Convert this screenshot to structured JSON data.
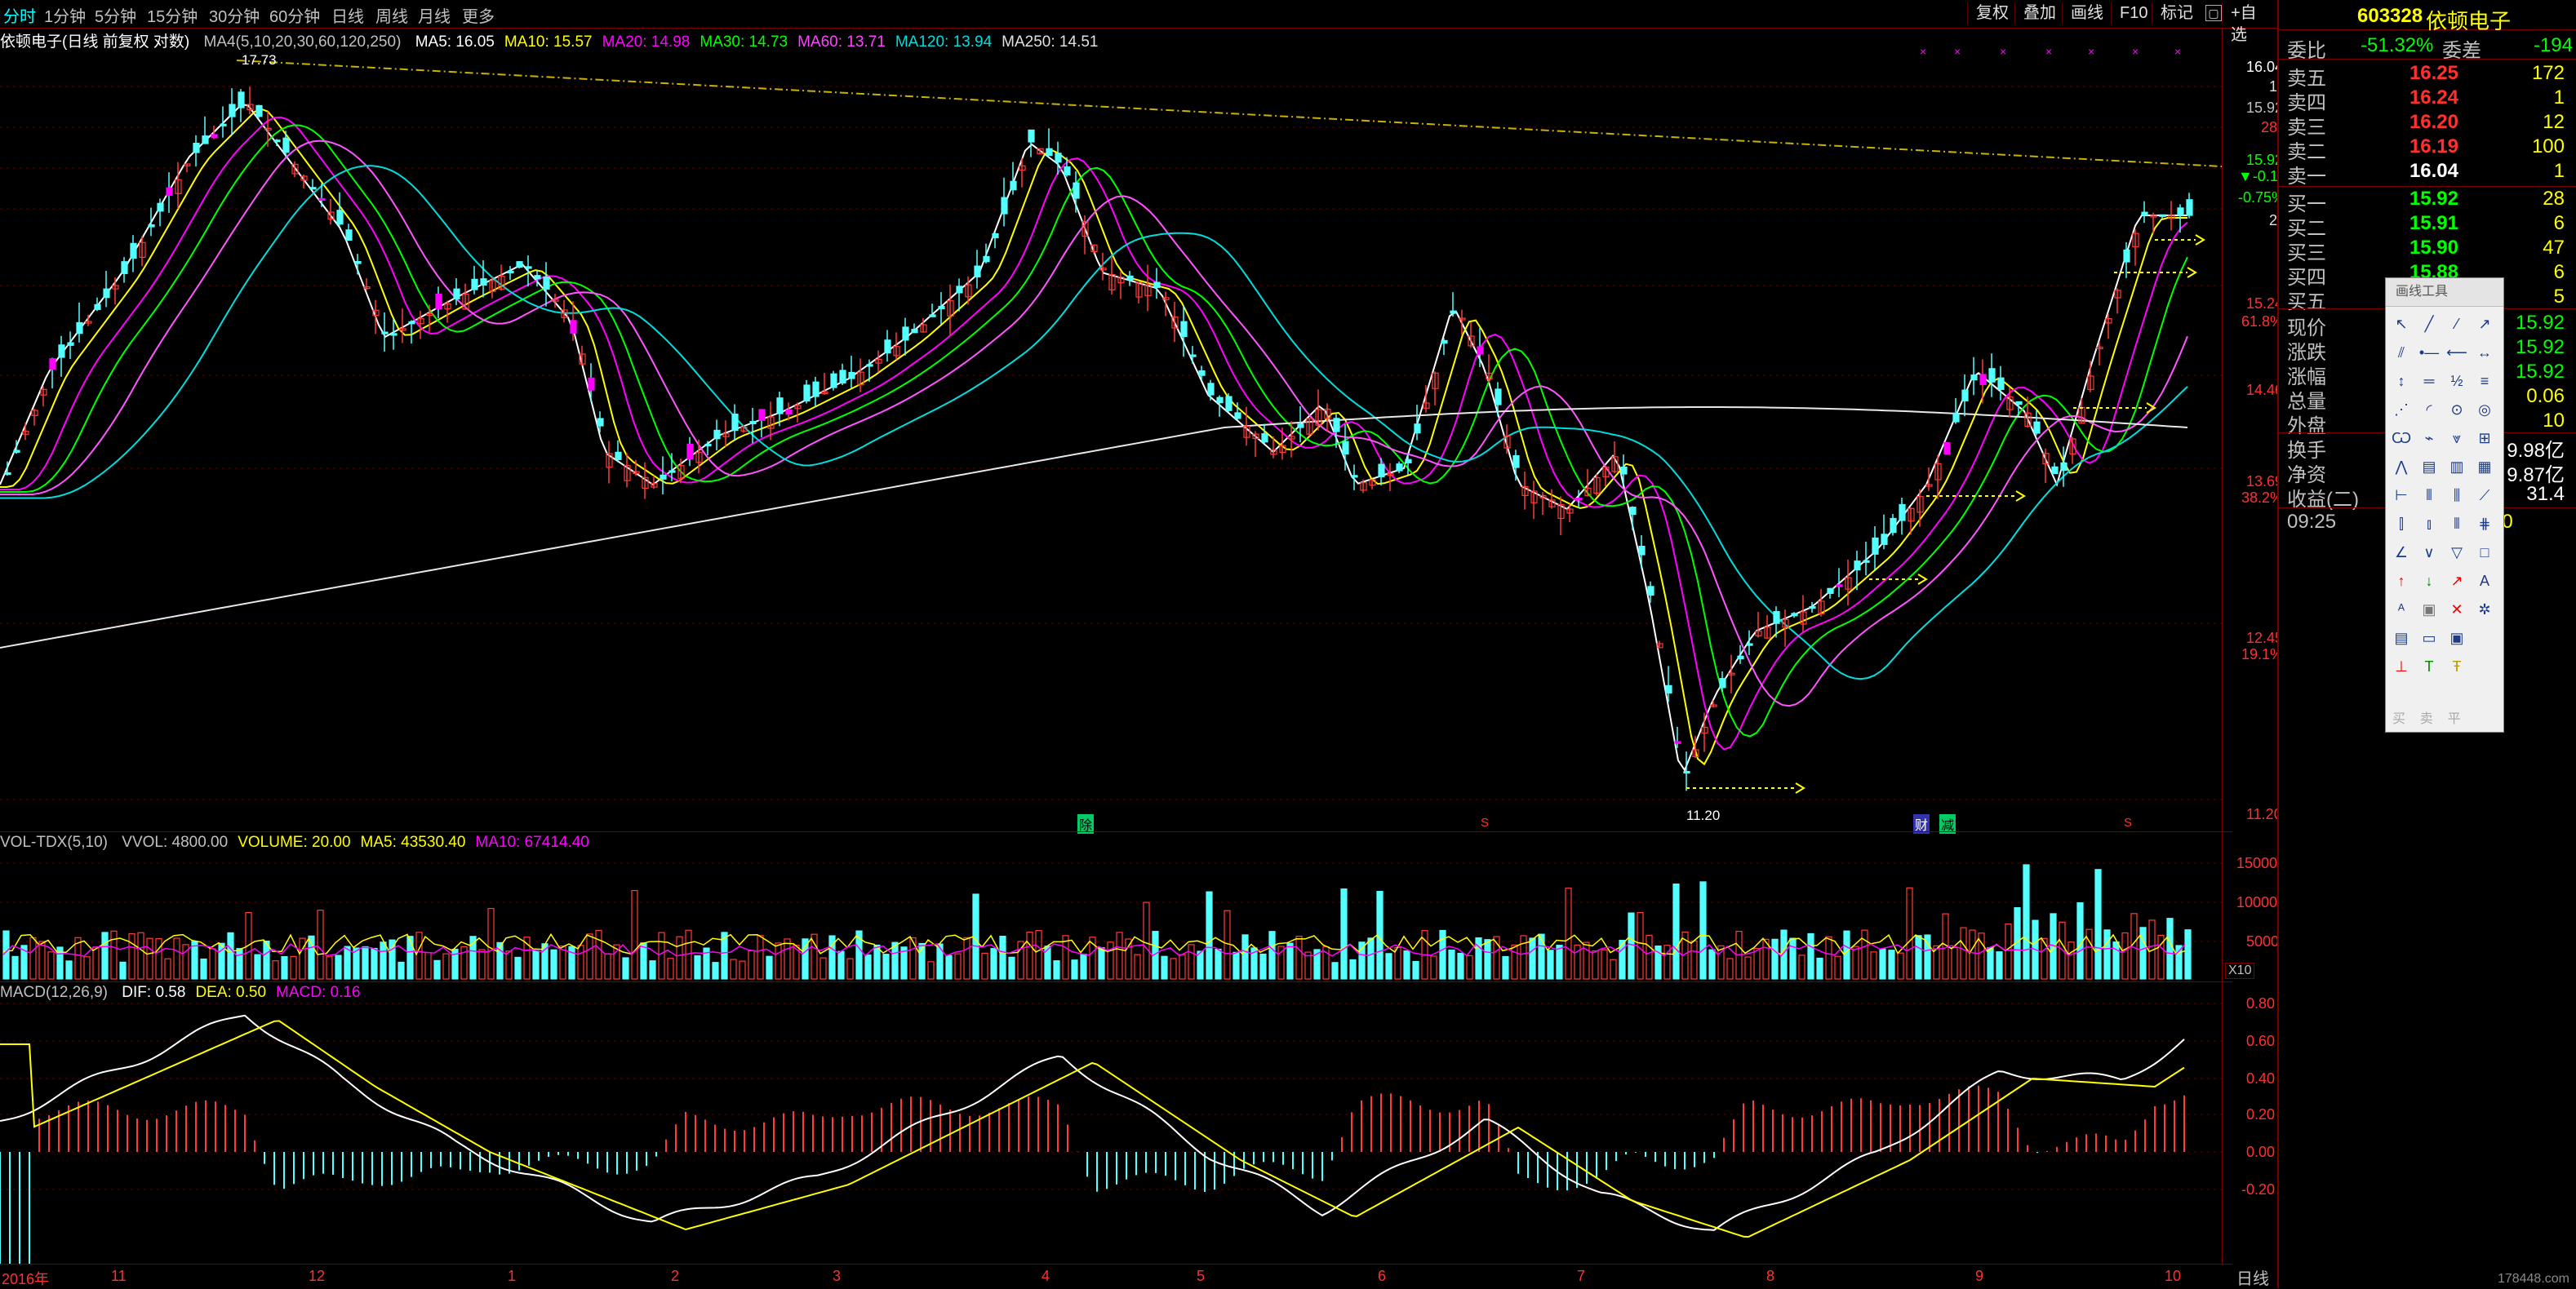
{
  "toolbar": {
    "period_tabs": [
      "分时",
      "1分钟",
      "5分钟",
      "15分钟",
      "30分钟",
      "60分钟",
      "日线",
      "周线",
      "月线",
      "更多"
    ],
    "active_tab": "分时",
    "right_buttons": [
      "复权",
      "叠加",
      "画线",
      "F10",
      "标记",
      "+自选",
      "返回"
    ]
  },
  "main_chart": {
    "title": "依顿电子(日线 前复权 对数)",
    "indicator": "MA4(5,10,20,30,60,120,250)",
    "ma_labels": [
      {
        "text": "MA5: 16.05",
        "color": "#ffffff"
      },
      {
        "text": "MA10: 15.57",
        "color": "#ffff00"
      },
      {
        "text": "MA20: 14.98",
        "color": "#ff00ff"
      },
      {
        "text": "MA30: 14.73",
        "color": "#00ff00"
      },
      {
        "text": "MA60: 13.71",
        "color": "#ff44ff"
      },
      {
        "text": "MA120: 13.94",
        "color": "#00dddd"
      },
      {
        "text": "MA250: 14.51",
        "color": "#e0e0e0"
      }
    ],
    "y_ticks": [
      "16.04",
      "15.92",
      "15.24",
      "14.46",
      "13.69",
      "12.45",
      "11.20"
    ],
    "side_values": {
      "v1": "1",
      "v2": "28",
      "v3": "▼-0.12",
      "v4": "-0.75%",
      "v5": "20",
      "pct1": "61.8%",
      "pct2": "38.2%",
      "pct3": "19.1%"
    },
    "annotations": {
      "high": "17.73",
      "low": "11.20"
    },
    "event_marks": [
      "除",
      "S",
      "财",
      "减",
      "S"
    ]
  },
  "volume_chart": {
    "title": "VOL-TDX(5,10)",
    "labels": [
      {
        "text": "VVOL: 4800.00",
        "color": "#c0c0c0"
      },
      {
        "text": "VOLUME: 20.00",
        "color": "#ffff00"
      },
      {
        "text": "MA5: 43530.40",
        "color": "#ffff00"
      },
      {
        "text": "MA10: 67414.40",
        "color": "#ff00ff"
      }
    ],
    "y_ticks": [
      "15000",
      "10000",
      "5000"
    ],
    "unit": "X10"
  },
  "macd_chart": {
    "title": "MACD(12,26,9)",
    "labels": [
      {
        "text": "DIF: 0.58",
        "color": "#ffffff"
      },
      {
        "text": "DEA: 0.50",
        "color": "#ffff00"
      },
      {
        "text": "MACD: 0.16",
        "color": "#ff00ff"
      }
    ],
    "y_ticks": [
      "0.80",
      "0.60",
      "0.40",
      "0.20",
      "0.00",
      "-0.20"
    ]
  },
  "x_axis": {
    "labels": [
      "2016年",
      "11",
      "12",
      "1",
      "2",
      "3",
      "4",
      "5",
      "6",
      "7",
      "8",
      "9",
      "10"
    ],
    "period_button": "日线"
  },
  "right_panel": {
    "code": "603328",
    "name": "依顿电子",
    "weibi_label": "委比",
    "weibi_value": "-51.32%",
    "weicha_label": "委差",
    "weicha_value": "-194",
    "asks": [
      {
        "label": "卖五",
        "price": "16.25",
        "qty": "172",
        "color": "#ff3030"
      },
      {
        "label": "卖四",
        "price": "16.24",
        "qty": "1",
        "color": "#ff3030"
      },
      {
        "label": "卖三",
        "price": "16.20",
        "qty": "12",
        "color": "#ff3030"
      },
      {
        "label": "卖二",
        "price": "16.19",
        "qty": "100",
        "color": "#ff3030"
      },
      {
        "label": "卖一",
        "price": "16.04",
        "qty": "1",
        "color": "#ffffff"
      }
    ],
    "bids": [
      {
        "label": "买一",
        "price": "15.92",
        "qty": "28",
        "color": "#00ff00"
      },
      {
        "label": "买二",
        "price": "15.91",
        "qty": "6",
        "color": "#00ff00"
      },
      {
        "label": "买三",
        "price": "15.90",
        "qty": "47",
        "color": "#00ff00"
      },
      {
        "label": "买四",
        "price": "15.88",
        "qty": "6",
        "color": "#00ff00"
      },
      {
        "label": "买五",
        "price": "",
        "qty": "5",
        "color": "#00ff00"
      }
    ],
    "stats": [
      {
        "label": "现价",
        "value": "15.92",
        "color": "#00ff00"
      },
      {
        "label": "涨跌",
        "value": "15.92",
        "color": "#00ff00"
      },
      {
        "label": "涨幅",
        "value": "15.92",
        "color": "#00ff00"
      },
      {
        "label": "总量",
        "value": "0.06",
        "color": "#ffff00"
      },
      {
        "label": "外盘",
        "value": "10",
        "color": "#ffff00"
      }
    ],
    "stats2": [
      {
        "label": "换手",
        "value": "9.98亿",
        "color": "#ffffff"
      },
      {
        "label": "净资",
        "value": "9.87亿",
        "color": "#ffffff"
      },
      {
        "label": "收益(二)",
        "value": "31.4",
        "color": "#ffffff"
      }
    ],
    "tick_time": "09:25",
    "tick_qty": "20"
  },
  "draw_tools": {
    "title": "画线工具",
    "footer": [
      "买",
      "卖",
      "平"
    ]
  },
  "watermark": "178448.com",
  "colors": {
    "up": "#ff3b3b",
    "down": "#54ffff",
    "frame": "#7a0000"
  }
}
